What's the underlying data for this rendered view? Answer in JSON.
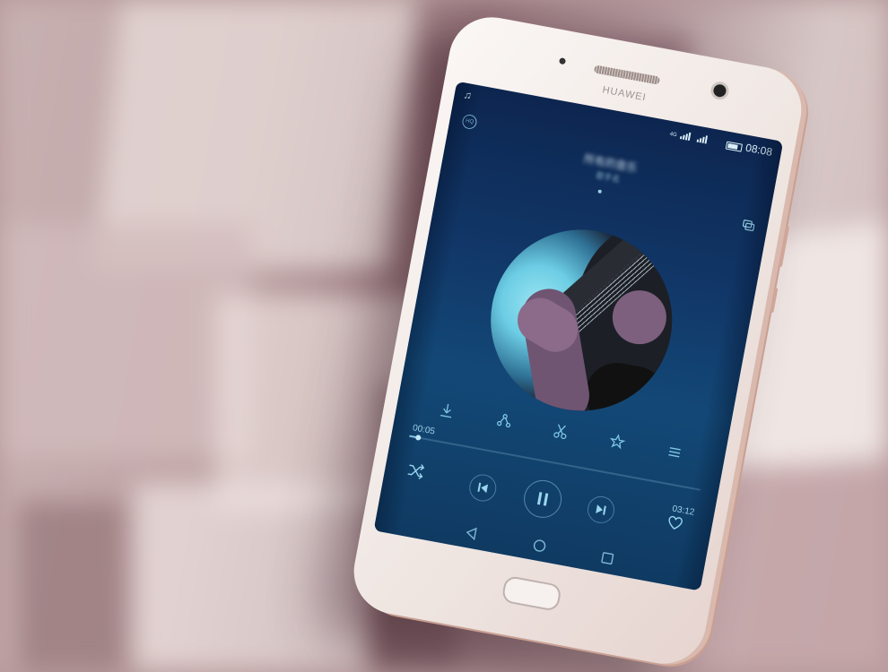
{
  "brand": "HUAWEI",
  "status_bar": {
    "network": "4G",
    "time": "08:08",
    "icons": [
      "music-note-icon",
      "signal-icon",
      "signal-icon",
      "battery-icon"
    ]
  },
  "player": {
    "quality_badge": "HQ",
    "song_title": "所有的音乐",
    "artist": "歌手名",
    "elapsed": "00:05",
    "duration": "03:12",
    "progress": 0.03,
    "state": "playing"
  },
  "actions": [
    "download-icon",
    "share-icon",
    "cut-icon",
    "effects-icon",
    "playlist-icon"
  ],
  "controls": [
    "shuffle-icon",
    "previous-icon",
    "pause-icon",
    "next-icon",
    "heart-icon"
  ],
  "nav": [
    "back-icon",
    "home-icon",
    "recents-icon"
  ],
  "colors": {
    "screen_top": "#0d2650",
    "screen_bottom": "#0f3a62",
    "accent": "#8fd3ef",
    "phone_body": "#f3ebe8"
  }
}
